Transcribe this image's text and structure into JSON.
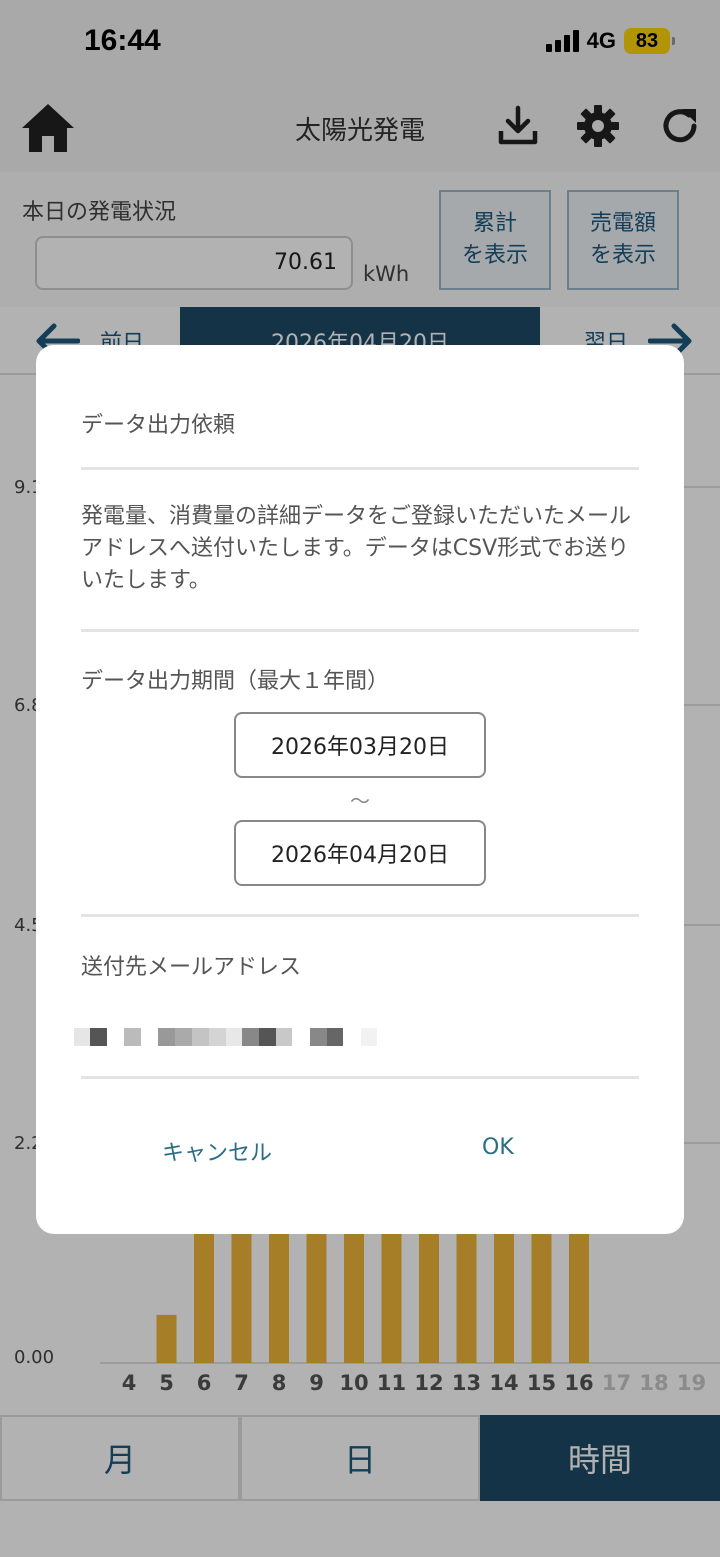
{
  "status_bar": {
    "time": "16:44",
    "network": "4G",
    "battery": "83"
  },
  "header": {
    "title": "太陽光発電"
  },
  "summary": {
    "label": "本日の発電状況",
    "value": "70.61",
    "unit": "kWh",
    "cumulative_line1": "累計",
    "cumulative_line2": "を表示",
    "sales_line1": "売電額",
    "sales_line2": "を表示"
  },
  "date_nav": {
    "prev": "前日",
    "current": "2026年04月20日",
    "next": "翌日"
  },
  "chart_data": {
    "type": "bar",
    "y_tick_labels": [
      "9.1",
      "6.8",
      "4.5",
      "2.2",
      "0.00"
    ],
    "categories": [
      "4",
      "5",
      "6",
      "7",
      "8",
      "9",
      "10",
      "11",
      "12",
      "13",
      "14",
      "15",
      "16",
      "17",
      "18",
      "19"
    ],
    "values": [
      0,
      0.5,
      9.6,
      9.6,
      9.6,
      9.6,
      9.6,
      9.6,
      9.6,
      9.6,
      9.6,
      9.6,
      2.65,
      0,
      0,
      0
    ],
    "ylim": [
      0,
      9.1
    ],
    "color": "#f0b53a",
    "faded_color": "#c8c8c8"
  },
  "tabs": {
    "month": "月",
    "day": "日",
    "hour": "時間"
  },
  "dialog": {
    "title": "データ出力依頼",
    "description": "発電量、消費量の詳細データをご登録いただいたメールアドレスへ送付いたします。データはCSV形式でお送りいたします。",
    "period_label": "データ出力期間（最大１年間）",
    "start_date": "2026年03月20日",
    "tilde": "〜",
    "end_date": "2026年04月20日",
    "email_label": "送付先メールアドレス",
    "cancel": "キャンセル",
    "ok": "OK"
  }
}
